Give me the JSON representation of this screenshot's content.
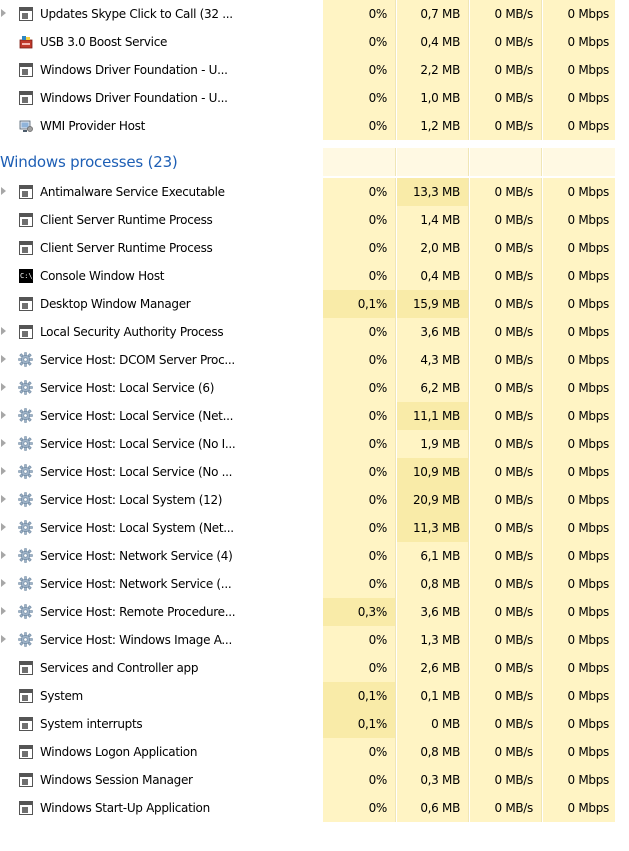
{
  "colors": {
    "cpu_light": "#fff4c4",
    "cpu_medium": "#f9eba8",
    "mem_light": "#fff4c4",
    "mem_medium": "#f9eba8",
    "group_header": "#1e5fb5"
  },
  "top_rows": [
    {
      "name": "Updates Skype Click to Call (32 ...",
      "icon": "window-icon",
      "expandable": true,
      "cpu": "0%",
      "memory": "0,7 MB",
      "disk": "0 MB/s",
      "network": "0 Mbps"
    },
    {
      "name": "USB 3.0 Boost Service",
      "icon": "usb-service-icon",
      "expandable": false,
      "cpu": "0%",
      "memory": "0,4 MB",
      "disk": "0 MB/s",
      "network": "0 Mbps"
    },
    {
      "name": "Windows Driver Foundation - U...",
      "icon": "window-icon",
      "expandable": false,
      "cpu": "0%",
      "memory": "2,2 MB",
      "disk": "0 MB/s",
      "network": "0 Mbps"
    },
    {
      "name": "Windows Driver Foundation - U...",
      "icon": "window-icon",
      "expandable": false,
      "cpu": "0%",
      "memory": "1,0 MB",
      "disk": "0 MB/s",
      "network": "0 Mbps"
    },
    {
      "name": "WMI Provider Host",
      "icon": "wmi-icon",
      "expandable": false,
      "cpu": "0%",
      "memory": "1,2 MB",
      "disk": "0 MB/s",
      "network": "0 Mbps"
    }
  ],
  "group": {
    "title": "Windows processes (23)"
  },
  "rows": [
    {
      "name": "Antimalware Service Executable",
      "icon": "window-icon",
      "expandable": true,
      "cpu": "0%",
      "memory": "13,3 MB",
      "disk": "0 MB/s",
      "network": "0 Mbps"
    },
    {
      "name": "Client Server Runtime Process",
      "icon": "window-icon",
      "expandable": false,
      "cpu": "0%",
      "memory": "1,4 MB",
      "disk": "0 MB/s",
      "network": "0 Mbps"
    },
    {
      "name": "Client Server Runtime Process",
      "icon": "window-icon",
      "expandable": false,
      "cpu": "0%",
      "memory": "2,0 MB",
      "disk": "0 MB/s",
      "network": "0 Mbps"
    },
    {
      "name": "Console Window Host",
      "icon": "console-icon",
      "expandable": false,
      "cpu": "0%",
      "memory": "0,4 MB",
      "disk": "0 MB/s",
      "network": "0 Mbps"
    },
    {
      "name": "Desktop Window Manager",
      "icon": "window-icon",
      "expandable": false,
      "cpu": "0,1%",
      "memory": "15,9 MB",
      "disk": "0 MB/s",
      "network": "0 Mbps"
    },
    {
      "name": "Local Security Authority Process",
      "icon": "window-icon",
      "expandable": true,
      "cpu": "0%",
      "memory": "3,6 MB",
      "disk": "0 MB/s",
      "network": "0 Mbps"
    },
    {
      "name": "Service Host: DCOM Server Proc...",
      "icon": "gear-icon",
      "expandable": true,
      "cpu": "0%",
      "memory": "4,3 MB",
      "disk": "0 MB/s",
      "network": "0 Mbps"
    },
    {
      "name": "Service Host: Local Service (6)",
      "icon": "gear-icon",
      "expandable": true,
      "cpu": "0%",
      "memory": "6,2 MB",
      "disk": "0 MB/s",
      "network": "0 Mbps"
    },
    {
      "name": "Service Host: Local Service (Net...",
      "icon": "gear-icon",
      "expandable": true,
      "cpu": "0%",
      "memory": "11,1 MB",
      "disk": "0 MB/s",
      "network": "0 Mbps"
    },
    {
      "name": "Service Host: Local Service (No I...",
      "icon": "gear-icon",
      "expandable": true,
      "cpu": "0%",
      "memory": "1,9 MB",
      "disk": "0 MB/s",
      "network": "0 Mbps"
    },
    {
      "name": "Service Host: Local Service (No ...",
      "icon": "gear-icon",
      "expandable": true,
      "cpu": "0%",
      "memory": "10,9 MB",
      "disk": "0 MB/s",
      "network": "0 Mbps"
    },
    {
      "name": "Service Host: Local System (12)",
      "icon": "gear-icon",
      "expandable": true,
      "cpu": "0%",
      "memory": "20,9 MB",
      "disk": "0 MB/s",
      "network": "0 Mbps"
    },
    {
      "name": "Service Host: Local System (Net...",
      "icon": "gear-icon",
      "expandable": true,
      "cpu": "0%",
      "memory": "11,3 MB",
      "disk": "0 MB/s",
      "network": "0 Mbps"
    },
    {
      "name": "Service Host: Network Service (4)",
      "icon": "gear-icon",
      "expandable": true,
      "cpu": "0%",
      "memory": "6,1 MB",
      "disk": "0 MB/s",
      "network": "0 Mbps"
    },
    {
      "name": "Service Host: Network Service (...",
      "icon": "gear-icon",
      "expandable": true,
      "cpu": "0%",
      "memory": "0,8 MB",
      "disk": "0 MB/s",
      "network": "0 Mbps"
    },
    {
      "name": "Service Host: Remote Procedure...",
      "icon": "gear-icon",
      "expandable": true,
      "cpu": "0,3%",
      "memory": "3,6 MB",
      "disk": "0 MB/s",
      "network": "0 Mbps"
    },
    {
      "name": "Service Host: Windows Image A...",
      "icon": "gear-icon",
      "expandable": true,
      "cpu": "0%",
      "memory": "1,3 MB",
      "disk": "0 MB/s",
      "network": "0 Mbps"
    },
    {
      "name": "Services and Controller app",
      "icon": "window-icon",
      "expandable": false,
      "cpu": "0%",
      "memory": "2,6 MB",
      "disk": "0 MB/s",
      "network": "0 Mbps"
    },
    {
      "name": "System",
      "icon": "window-icon",
      "expandable": false,
      "cpu": "0,1%",
      "memory": "0,1 MB",
      "disk": "0 MB/s",
      "network": "0 Mbps"
    },
    {
      "name": "System interrupts",
      "icon": "window-icon",
      "expandable": false,
      "cpu": "0,1%",
      "memory": "0 MB",
      "disk": "0 MB/s",
      "network": "0 Mbps"
    },
    {
      "name": "Windows Logon Application",
      "icon": "window-icon",
      "expandable": false,
      "cpu": "0%",
      "memory": "0,8 MB",
      "disk": "0 MB/s",
      "network": "0 Mbps"
    },
    {
      "name": "Windows Session Manager",
      "icon": "window-icon",
      "expandable": false,
      "cpu": "0%",
      "memory": "0,3 MB",
      "disk": "0 MB/s",
      "network": "0 Mbps"
    },
    {
      "name": "Windows Start-Up Application",
      "icon": "window-icon",
      "expandable": false,
      "cpu": "0%",
      "memory": "0,6 MB",
      "disk": "0 MB/s",
      "network": "0 Mbps"
    }
  ]
}
